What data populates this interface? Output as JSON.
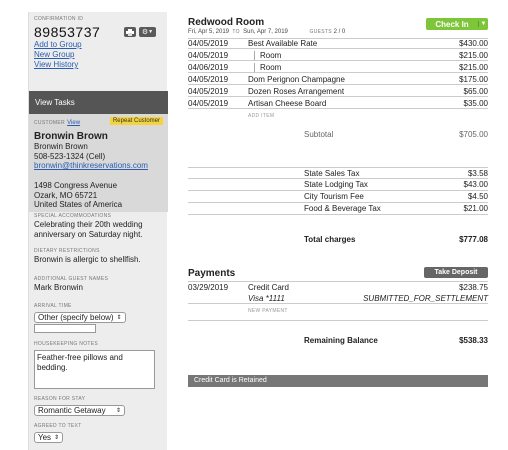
{
  "sidebar": {
    "confirmation_label": "CONFIRMATION ID",
    "confirmation_id": "89853737",
    "links": [
      "Add to Group",
      "New Group",
      "View History"
    ],
    "view_tasks": "View Tasks",
    "customer_label": "CUSTOMER",
    "customer_view": "View",
    "repeat_badge": "Repeat Customer",
    "customer_name": "Bronwin Brown",
    "contact": [
      "Bronwin Brown",
      "508-523-1324 (Cell)"
    ],
    "email": "bronwin@thinkreservations.com",
    "address": [
      "1498 Congress Avenue",
      "Ozark, MO 65721",
      "United States of America"
    ],
    "special_label": "SPECIAL ACCOMMODATIONS",
    "special_text": "Celebrating their 20th wedding anniversary on Saturday night.",
    "dietary_label": "DIETARY RESTRICTIONS",
    "dietary_text": "Bronwin is allergic to shellfish.",
    "guests_label": "ADDITIONAL GUEST NAMES",
    "guests_text": "Mark Bronwin",
    "arrival_label": "ARRIVAL TIME",
    "arrival_value": "Other (specify below)",
    "housekeeping_label": "HOUSEKEEPING NOTES",
    "housekeeping_text": "Feather-free pillows and bedding.",
    "reason_label": "REASON FOR STAY",
    "reason_value": "Romantic Getaway",
    "agreed_label": "AGREED TO TEXT",
    "agreed_value": "Yes"
  },
  "main": {
    "room_title": "Redwood Room",
    "checkin_label": "Check In",
    "date_from": "Fri, Apr 5, 2019",
    "date_to_label": "TO",
    "date_to": "Sun, Apr 7, 2019",
    "guests_label": "GUESTS",
    "guests_value": "2 / 0",
    "items": [
      {
        "date": "04/05/2019",
        "desc": "Best Available Rate",
        "amount": "$430.00"
      },
      {
        "date": "04/05/2019",
        "desc": "Room",
        "amount": "$215.00"
      },
      {
        "date": "04/06/2019",
        "desc": "Room",
        "amount": "$215.00"
      },
      {
        "date": "04/05/2019",
        "desc": "Dom Perignon Champagne",
        "amount": "$175.00"
      },
      {
        "date": "04/05/2019",
        "desc": "Dozen Roses Arrangement",
        "amount": "$65.00"
      },
      {
        "date": "04/05/2019",
        "desc": "Artisan Cheese Board",
        "amount": "$35.00"
      }
    ],
    "add_item": "ADD ITEM",
    "subtotal_label": "Subtotal",
    "subtotal_value": "$705.00",
    "taxes": [
      {
        "name": "State Sales Tax",
        "amount": "$3.58"
      },
      {
        "name": "State Lodging Tax",
        "amount": "$43.00"
      },
      {
        "name": "City Tourism Fee",
        "amount": "$4.50"
      },
      {
        "name": "Food & Beverage Tax",
        "amount": "$21.00"
      }
    ],
    "total_label": "Total charges",
    "total_value": "$777.08"
  },
  "payments": {
    "title": "Payments",
    "take_deposit": "Take Deposit",
    "date": "03/29/2019",
    "method": "Credit Card",
    "amount": "$238.75",
    "card": "Visa *1111",
    "status": "SUBMITTED_FOR_SETTLEMENT",
    "new_payment": "NEW PAYMENT",
    "remaining_label": "Remaining Balance",
    "remaining_value": "$538.33",
    "retained": "Credit Card is Retained"
  }
}
